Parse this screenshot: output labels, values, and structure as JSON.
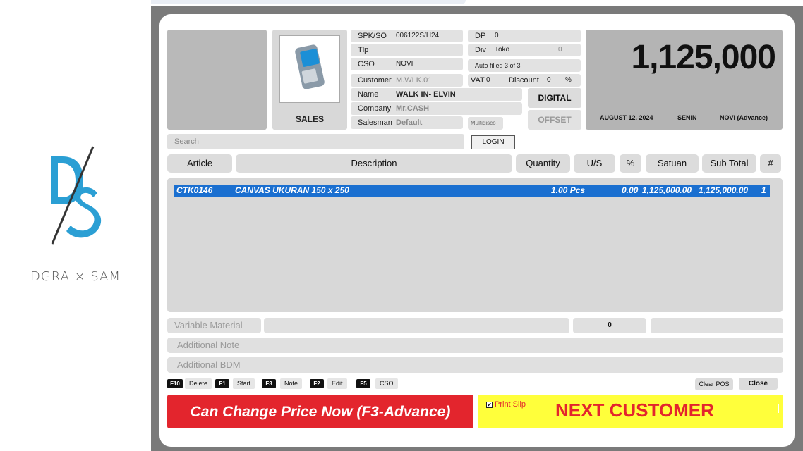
{
  "brand": {
    "text": "DGRA × SAM",
    "primary_color": "#2b9fd4",
    "dark_color": "#333333"
  },
  "header": {
    "sales_label": "SALES",
    "fields": {
      "spk_label": "SPK/SO",
      "spk_value": "006122S/H24",
      "tlp_label": "Tlp",
      "tlp_value": "",
      "cso_label": "CSO",
      "cso_value": "NOVI",
      "customer_label": "Customer",
      "customer_value": "M.WLK.01",
      "name_label": "Name",
      "name_value": "WALK IN- ELVIN",
      "company_label": "Company",
      "company_value": "Mr.CASH",
      "salesman_label": "Salesman",
      "salesman_value": "Default",
      "dp_label": "DP",
      "dp_value": "0",
      "div_label": "Div",
      "div_value": "Toko",
      "div_count": "0",
      "autofill_text": "Auto filled 3 of 3",
      "vat_label": "VAT",
      "vat_value": "0",
      "discount_label": "Discount",
      "discount_value": "0",
      "discount_unit": "%",
      "multidisc_label": "Multidisco"
    },
    "buttons": {
      "digital": "DIGITAL",
      "offset": "OFFSET"
    },
    "total": {
      "amount": "1,125,000",
      "date": "AUGUST 12. 2024",
      "day": "SENIN",
      "user": "NOVI (Advance)"
    }
  },
  "search": {
    "placeholder": "Search",
    "login_label": "LOGIN"
  },
  "columns": [
    "Article",
    "Description",
    "Quantity",
    "U/S",
    "%",
    "Satuan",
    "Sub Total",
    "#"
  ],
  "rows": [
    {
      "article": "CTK0146",
      "description": "CANVAS UKURAN 150 x 250",
      "quantity": "1.00 Pcs",
      "pct": "0.00",
      "satuan": "1,125,000.00",
      "subtotal": "1,125,000.00",
      "num": "1"
    }
  ],
  "bottom": {
    "variable_material": "Variable Material",
    "variable_value": "0",
    "additional_note": "Additional Note",
    "additional_bdm": "Additional BDM"
  },
  "shortcuts": [
    {
      "key": "F10",
      "label": "Delete"
    },
    {
      "key": "F1",
      "label": "Start"
    },
    {
      "key": "F3",
      "label": "Note"
    },
    {
      "key": "F2",
      "label": "Edit"
    },
    {
      "key": "F5",
      "label": "CSO"
    }
  ],
  "actions": {
    "clear_pos": "Clear POS",
    "close": "Close",
    "change_price": "Can Change Price Now (F3-Advance)",
    "print_slip": "Print Slip",
    "print_slip_checked": true,
    "next_customer": "NEXT CUSTOMER"
  }
}
